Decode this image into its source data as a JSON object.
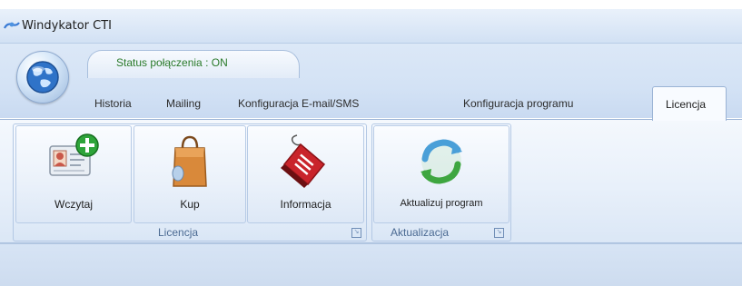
{
  "window": {
    "title": "Windykator CTI"
  },
  "status": {
    "text": "Status połączenia : ON"
  },
  "tabs": [
    {
      "label": "Historia"
    },
    {
      "label": "Mailing"
    },
    {
      "label": "Konfiguracja E-mail/SMS"
    },
    {
      "label": "Konfiguracja programu"
    },
    {
      "label": "Licencja",
      "active": true
    }
  ],
  "groups": [
    {
      "label": "Licencja",
      "buttons": [
        {
          "label": "Wczytaj",
          "icon": "id-card-add-icon"
        },
        {
          "label": "Kup",
          "icon": "shopping-bag-icon"
        },
        {
          "label": "Informacja",
          "icon": "tag-info-icon"
        }
      ]
    },
    {
      "label": "Aktualizacja",
      "buttons": [
        {
          "label": "Aktualizuj program",
          "icon": "refresh-icon"
        }
      ]
    }
  ],
  "colors": {
    "accent": "#2a7a2a",
    "ribbon": "#d3e2f5"
  }
}
